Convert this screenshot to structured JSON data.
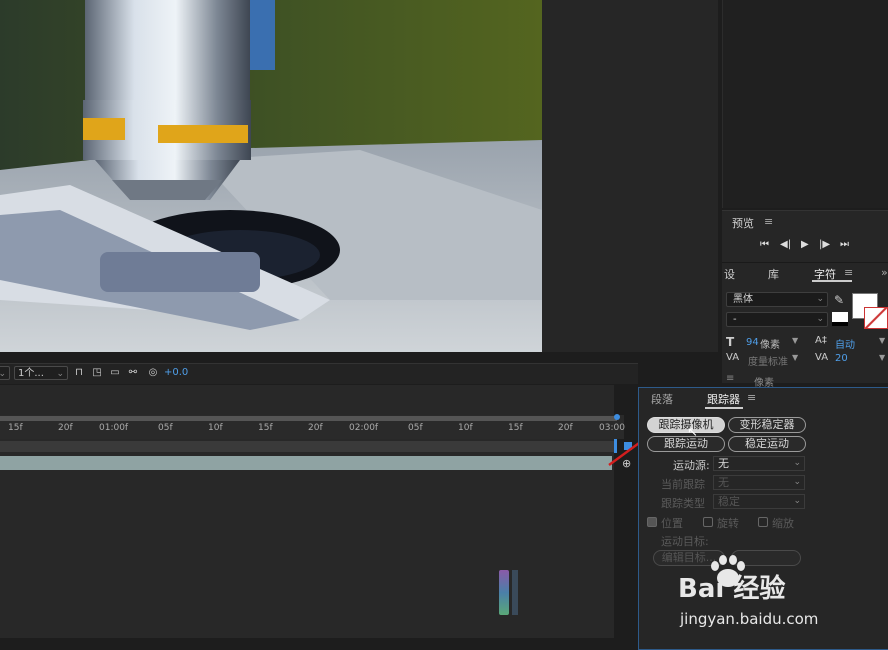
{
  "viewer_toolbar": {
    "view_select": "1个...",
    "exposure": "+0.0"
  },
  "preview_panel": {
    "title": "预览",
    "menu": "≡"
  },
  "char_panel": {
    "tabs": [
      "设",
      "库",
      "字符"
    ],
    "menu": "≡",
    "font_family": "黑体",
    "font_style": "-",
    "font_size_value": "94",
    "font_size_unit": "像素",
    "leading": "自动",
    "kerning_label": "度量标准",
    "tracking": "20",
    "partial_row": "像素"
  },
  "timeline": {
    "ticks": [
      "15f",
      "20f",
      "01:00f",
      "05f",
      "10f",
      "15f",
      "20f",
      "02:00f",
      "05f",
      "10f",
      "15f",
      "20f",
      "03:00"
    ]
  },
  "tracker_panel": {
    "tabs": [
      "段落",
      "跟踪器"
    ],
    "menu": "≡",
    "buttons": {
      "track_camera": "跟踪摄像机",
      "warp_stabilizer": "变形稳定器",
      "track_motion": "跟踪运动",
      "stabilize_motion": "稳定运动"
    },
    "motion_source_label": "运动源:",
    "motion_source_value": "无",
    "current_track_label": "当前跟踪",
    "current_track_value": "无",
    "track_type_label": "跟踪类型",
    "track_type_value": "稳定",
    "position_label": "位置",
    "rotation_label": "旋转",
    "scale_label": "缩放",
    "motion_target_label": "运动目标:",
    "edit_target": "编辑目标..."
  },
  "watermark": {
    "brand_text": "Bai 经验",
    "url": "jingyan.baidu.com"
  }
}
